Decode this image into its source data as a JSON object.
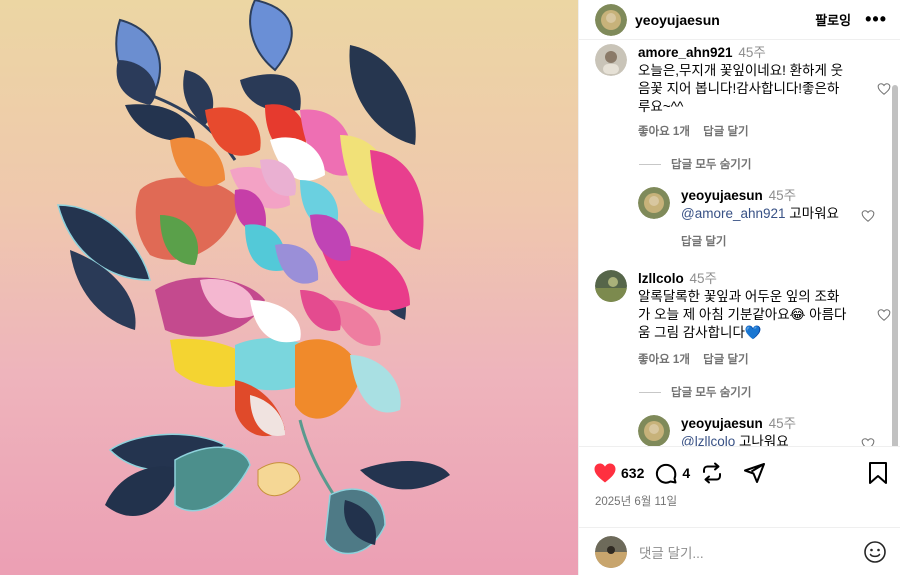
{
  "post": {
    "author": "yeoyujaesun",
    "follow_label": "팔로잉",
    "more_label": "•••"
  },
  "comments": [
    {
      "user": "amore_ahn921",
      "time": "45주",
      "text": "오늘은,무지개 꽃잎이네요! 환하게 웃음꽃 지어 봅니다!감사합니다!좋은하루요~^^",
      "likes": "좋아요 1개",
      "reply_label": "답글 달기",
      "thread_toggle": "답글 모두 숨기기",
      "reply": {
        "user": "yeoyujaesun",
        "time": "45주",
        "mention": "@amore_ahn921",
        "text": " 고마워요",
        "reply_label": "답글 달기"
      }
    },
    {
      "user": "lzllcolo",
      "time": "45주",
      "text": "알록달록한 꽃잎과 어두운 잎의 조화가 오늘 제 아침 기분같아요😂 아름다움 그림 감사합니다💙",
      "likes": "좋아요 1개",
      "reply_label": "답글 달기",
      "thread_toggle": "답글 모두 숨기기",
      "reply": {
        "user": "yeoyujaesun",
        "time": "45주",
        "mention": "@lzllcolo",
        "text": " 고나워요"
      }
    }
  ],
  "actions": {
    "like_count": "632",
    "comment_count": "4",
    "date": "2025년 6월 11일"
  },
  "add_comment": {
    "placeholder": "댓글 달기..."
  },
  "colors": {
    "like_red": "#ff3040",
    "mention_blue": "#385185",
    "muted": "#737373"
  }
}
